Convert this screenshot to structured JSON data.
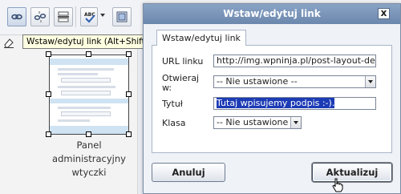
{
  "toolbar": {
    "buttons": [
      {
        "name": "insert-link-icon"
      },
      {
        "name": "unlink-icon"
      },
      {
        "name": "horizontal-rule-icon"
      },
      {
        "name": "spellcheck-icon",
        "label": "ABC"
      },
      {
        "name": "fullscreen-icon"
      }
    ]
  },
  "tooltip": {
    "text": "Wstaw/edytuj link (Alt+Shift+A)"
  },
  "widget": {
    "caption_lines": [
      "Panel",
      "administracyjny",
      "wtyczki"
    ]
  },
  "dialog": {
    "title": "Wstaw/edytuj link",
    "close_label": "x",
    "tab_label": "Wstaw/edytuj link",
    "fields": {
      "url_label": "URL linku",
      "url_value": "http://img.wpninja.pl/post-layout-demo.png",
      "target_label_line1": "Otwieraj",
      "target_label_line2": "w:",
      "target_value": "-- Nie ustawione --",
      "title_label": "Tytuł",
      "title_value": "Tutaj wpisujemy podpis :-).",
      "class_label": "Klasa",
      "class_value": "-- Nie ustawione --"
    },
    "cancel_label": "Anuluj",
    "update_label": "Aktualizuj"
  },
  "colors": {
    "titlebar": "#7d97bb",
    "selection": "#1c3bb5",
    "tooltip_bg": "#ffffe1"
  }
}
